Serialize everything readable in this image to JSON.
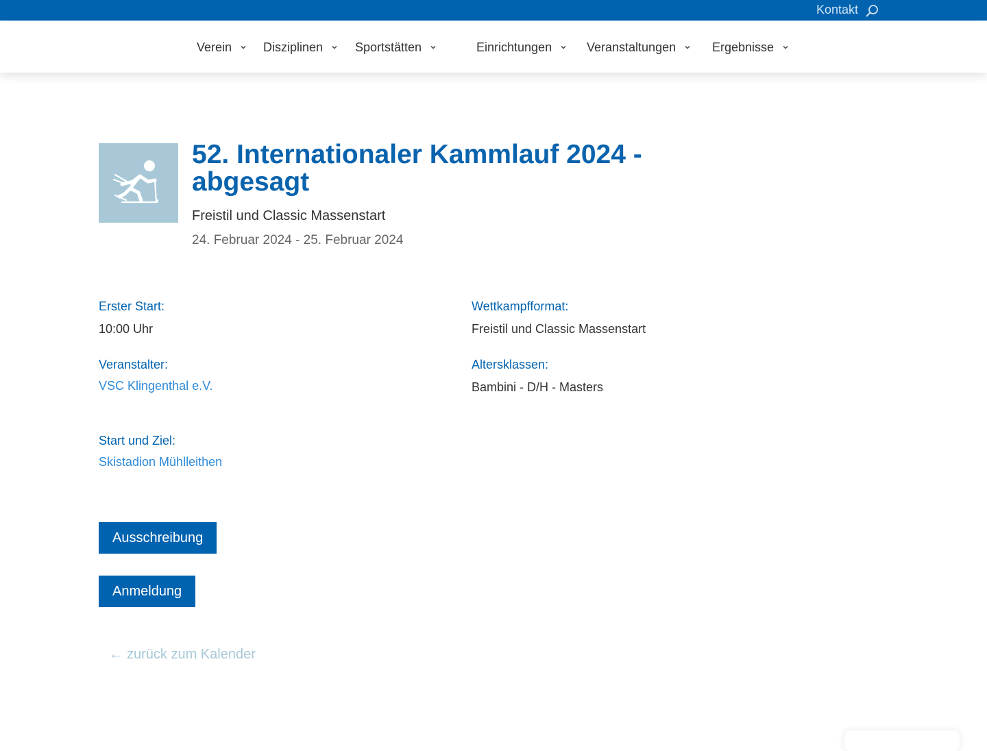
{
  "topbar": {
    "contact_label": "Kontakt",
    "search_icon": "search-icon"
  },
  "nav": {
    "items": [
      {
        "label": "Verein"
      },
      {
        "label": "Disziplinen"
      },
      {
        "label": "Sportstätten"
      },
      {
        "label": "Einrichtungen"
      },
      {
        "label": "Veranstaltungen"
      },
      {
        "label": "Ergebnisse"
      }
    ],
    "chevron_icon": "chevron-down-icon"
  },
  "event": {
    "icon": "cross-country-skier-icon",
    "title": "52. Internationaler Kammlauf 2024 -abgesagt",
    "subtitle": "Freistil und Classic Massenstart",
    "dates": "24. Februar 2024 - 25. Februar 2024"
  },
  "details": {
    "first_start_label": "Erster Start:",
    "first_start_value": "10:00 Uhr",
    "format_label": "Wettkampfformat:",
    "format_value": "Freistil und Classic Massenstart",
    "organizer_label": "Veranstalter:",
    "organizer_value": "VSC Klingenthal e.V.",
    "age_classes_label": "Altersklassen:",
    "age_classes_value": "Bambini - D/H - Masters",
    "venue_label": "Start und Ziel:",
    "venue_value": "Skistadion Mühlleithen"
  },
  "buttons": {
    "tender_label": "Ausschreibung",
    "registration_label": "Anmeldung"
  },
  "back": {
    "arrow": "←",
    "label": "zurück zum Kalender"
  },
  "colors": {
    "brand_blue": "#0063b0",
    "link_blue": "#2e8ad8",
    "icon_bg": "#a8c8d8"
  }
}
